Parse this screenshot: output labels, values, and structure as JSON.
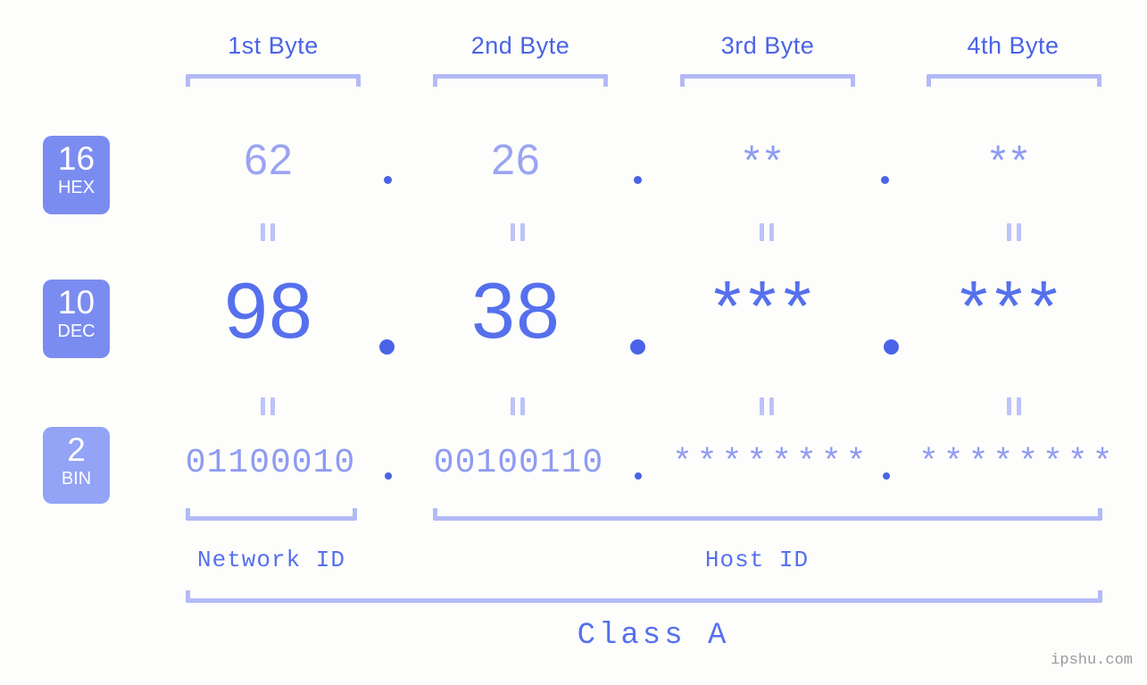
{
  "meta": {
    "background_color": "#fdfefb",
    "accent_color": "#5670ed",
    "light_accent_color": "#8e9bf2",
    "bracket_color": "#b3baf7",
    "badge_dark_color": "#7b8cf0",
    "badge_light_color": "#93a3f5"
  },
  "headers": [
    {
      "label": "1st Byte"
    },
    {
      "label": "2nd Byte"
    },
    {
      "label": "3rd Byte"
    },
    {
      "label": "4th Byte"
    }
  ],
  "bases": [
    {
      "number": "16",
      "abbr": "HEX"
    },
    {
      "number": "10",
      "abbr": "DEC"
    },
    {
      "number": "2",
      "abbr": "BIN"
    }
  ],
  "rows": {
    "hex": {
      "base_number": "16",
      "base_abbr": "HEX",
      "values": [
        "62",
        "26",
        "**",
        "**"
      ]
    },
    "dec": {
      "base_number": "10",
      "base_abbr": "DEC",
      "values": [
        "98",
        "38",
        "***",
        "***"
      ]
    },
    "bin": {
      "base_number": "2",
      "base_abbr": "BIN",
      "values": [
        "01100010",
        "00100110",
        "********",
        "********"
      ]
    }
  },
  "separators": {
    "hex": [
      ".",
      ".",
      "."
    ],
    "dec": [
      ".",
      ".",
      "."
    ],
    "bin": [
      ".",
      ".",
      "."
    ]
  },
  "equality_marks": {
    "glyph": "=",
    "count_per_row": 4,
    "rows": 2
  },
  "sections": [
    {
      "label": "Network ID"
    },
    {
      "label": "Host ID"
    }
  ],
  "class": {
    "label": "Class A"
  },
  "watermark": {
    "text": "ipshu.com"
  }
}
